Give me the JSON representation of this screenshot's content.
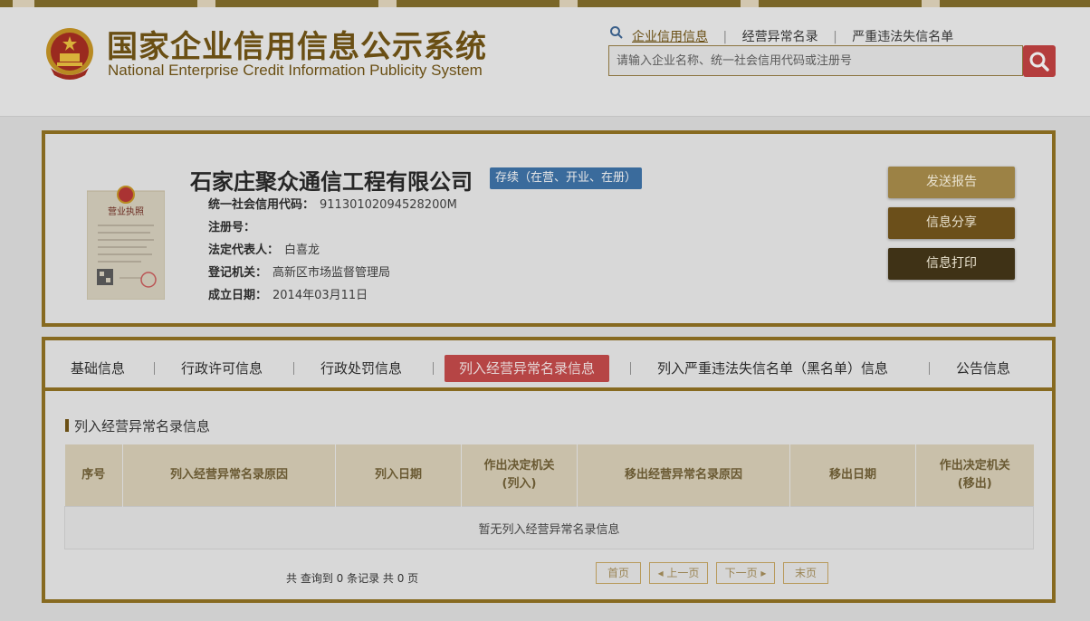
{
  "header": {
    "title_cn": "国家企业信用信息公示系统",
    "title_en": "National Enterprise Credit Information Publicity System",
    "nav": [
      "企业信用信息",
      "经营异常名录",
      "严重违法失信名单"
    ],
    "search_placeholder": "请输入企业名称、统一社会信用代码或注册号"
  },
  "company": {
    "name": "石家庄聚众通信工程有限公司",
    "status": "存续（在营、开业、在册）",
    "license_label": "营业执照",
    "fields": [
      {
        "label": "统一社会信用代码：",
        "value": "91130102094528200M"
      },
      {
        "label": "注册号：",
        "value": ""
      },
      {
        "label": "法定代表人：",
        "value": "白喜龙"
      },
      {
        "label": "登记机关：",
        "value": "高新区市场监督管理局"
      },
      {
        "label": "成立日期：",
        "value": "2014年03月11日"
      }
    ],
    "buttons": {
      "report": "发送报告",
      "share": "信息分享",
      "print": "信息打印"
    }
  },
  "tabs": [
    "基础信息",
    "行政许可信息",
    "行政处罚信息",
    "列入经营异常名录信息",
    "列入严重违法失信名单（黑名单）信息",
    "公告信息"
  ],
  "active_tab": 3,
  "section": {
    "title": "列入经营异常名录信息",
    "columns": [
      "序号",
      "列入经营异常名录原因",
      "列入日期",
      "作出决定机关\n(列入)",
      "移出经营异常名录原因",
      "移出日期",
      "作出决定机关\n(移出)"
    ],
    "empty_text": "暂无列入经营异常名录信息",
    "count_text": "共 查询到 0 条记录 共 0 页"
  },
  "pager": {
    "first": "首页",
    "prev": "上一页",
    "next": "下一页",
    "last": "末页"
  },
  "colors": {
    "brand": "#6a4f14",
    "frame": "#876a20",
    "active_tab": "#b64545",
    "status": "#3a6b9c"
  }
}
